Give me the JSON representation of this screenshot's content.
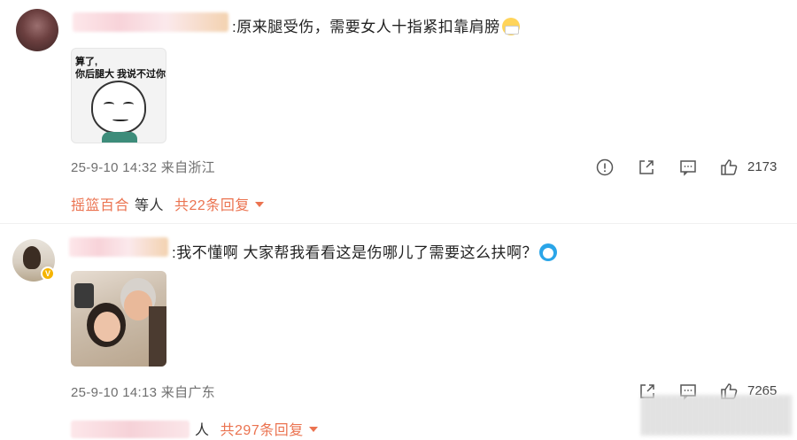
{
  "comments": [
    {
      "text": ":原来腿受伤，需要女人十指紧扣靠肩膀",
      "emoji": "mask-face-emoji",
      "image": {
        "caption_line1": "算了,",
        "caption_line2": "你后腿大 我说不过你"
      },
      "timestamp": "25-9-10 14:32",
      "location": "来自浙江",
      "likes": "2173",
      "reply_name": "摇篮百合",
      "reply_etc": "等人",
      "reply_count": "共22条回复"
    },
    {
      "text": ":我不懂啊 大家帮我看看这是伤哪儿了需要这么扶啊？",
      "emoji": "doraemon-emoji",
      "timestamp": "25-9-10 14:13",
      "location": "来自广东",
      "likes": "7265",
      "reply_etc": "人",
      "reply_count": "共297条回复"
    }
  ],
  "icons": {
    "report": "report-icon",
    "share": "share-icon",
    "comment": "comment-icon",
    "like": "like-icon"
  },
  "colors": {
    "accent": "#eb7350",
    "meta": "#6f6f6f"
  }
}
